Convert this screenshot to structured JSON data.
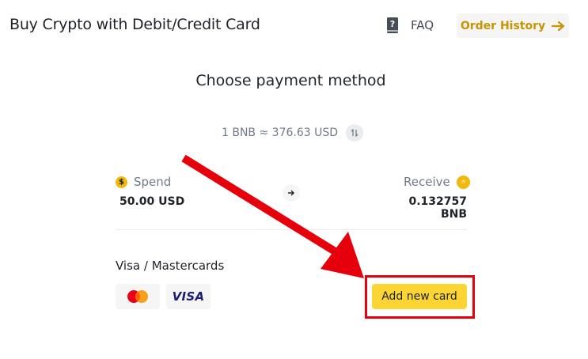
{
  "header": {
    "title": "Buy Crypto with Debit/Credit Card",
    "faq_label": "FAQ",
    "faq_icon": "faq-book-icon",
    "order_history_label": "Order History",
    "order_history_icon": "arrow-right-icon"
  },
  "main": {
    "section_title": "Choose payment method",
    "rate_text": "1 BNB ≈ 376.63 USD",
    "rate_icon": "swap-icon",
    "spend": {
      "label": "Spend",
      "value": "50.00 USD",
      "icon": "dollar-coin-icon",
      "icon_glyph": "$"
    },
    "receive": {
      "label": "Receive",
      "value": "0.132757 BNB",
      "icon": "bnb-icon"
    },
    "direction_icon": "arrow-right-icon",
    "payment": {
      "label": "Visa / Mastercards",
      "cards": [
        "mastercard-logo",
        "visa-logo"
      ],
      "visa_text": "VISA",
      "add_card_label": "Add new card"
    }
  },
  "annotation": {
    "highlight_color": "#e6000c",
    "target": "Add new card"
  },
  "colors": {
    "brand_yellow": "#fcd535",
    "accent_gold": "#c99400",
    "text_primary": "#1e2329",
    "text_secondary": "#707a8a"
  }
}
